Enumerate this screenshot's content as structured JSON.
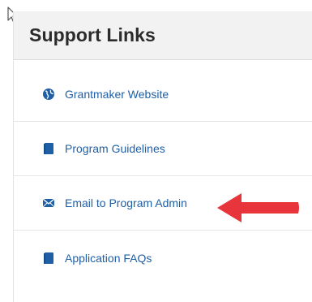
{
  "panel": {
    "title": "Support Links"
  },
  "links": [
    {
      "label": "Grantmaker Website",
      "icon": "globe-icon"
    },
    {
      "label": "Program Guidelines",
      "icon": "book-icon"
    },
    {
      "label": "Email to Program Admin",
      "icon": "envelope-icon"
    },
    {
      "label": "Application FAQs",
      "icon": "book-icon"
    }
  ],
  "annotation": {
    "arrow_color": "#e8343b",
    "points_to": "Email to Program Admin"
  },
  "colors": {
    "link": "#1f5fa6",
    "icon": "#1f5fa6",
    "header_bg": "#f2f2f2"
  }
}
